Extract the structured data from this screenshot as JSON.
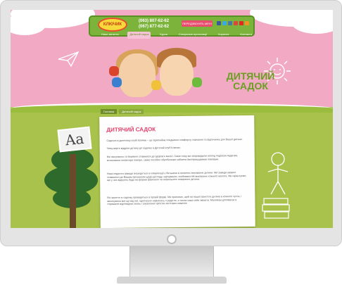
{
  "header": {
    "logo_text": "КЛЮЧИК",
    "phones": [
      "(063) 807-62-62",
      "(067) 877-62-62"
    ],
    "callback_label": "ПЕРЕДЗВОНІТЬ МЕНІ"
  },
  "nav": {
    "items": [
      "Наші заняття",
      "Дитячий садок",
      "Курси",
      "Спеціальні пропозиції",
      "Корисне",
      "Контакти"
    ],
    "active_index": 1
  },
  "hero": {
    "title_line1": "ДИТЯЧИЙ",
    "title_line2": "САДОК"
  },
  "breadcrumb": {
    "home": "Головна",
    "current": "Дитячий садок"
  },
  "board": {
    "letters": "Aa"
  },
  "article": {
    "title": "ДИТЯЧИЙ САДОК",
    "paragraphs": [
      "Садочок в дитячому клубі Ключик – це гармонійне поєднання комфорту, навчання та відпочинку для Вашої дитини.",
      "Чому варто віддати дитину до садочку в Дитячий клуб Ключик:",
      "Ми піклуємося та бережно ставимося до здоров'я малят. Саме тому ми запровадили нагляд педіатра-педіатра, встановили іонізатори повітря, свіжа постійно оброблюємо кабінети бактерицидними лампами.",
      "Наші педагоги завжди знаходяться в комунікації з батьками в питаннях виховання дитини. Ми завжди уважно ставимося до Вашим проханням щодо догляду, харчування, особливостей виховання кожного малята. Ми гарантуємо, що у нас відчують будь-які форми фізичного чи морального покарання дитини.",
      "Всі заняття в садочку проводяться в ігровій формі. Ми прагнемо, щоб на нашої заняттях дитина в кожного чутла, і виконувала все що від неї, одночасно навчалась з радістю, а також сама себе змінити. Малюкам допомагає в отриманні відповідних знань і засвоєнню простих життєвих навичок."
    ]
  },
  "colors": {
    "hero_pink": "#f2a9c3",
    "grass_green": "#a8c24c",
    "header_green": "#7bb33b",
    "title_green": "#6a9f22",
    "accent_pink": "#e4406a"
  }
}
